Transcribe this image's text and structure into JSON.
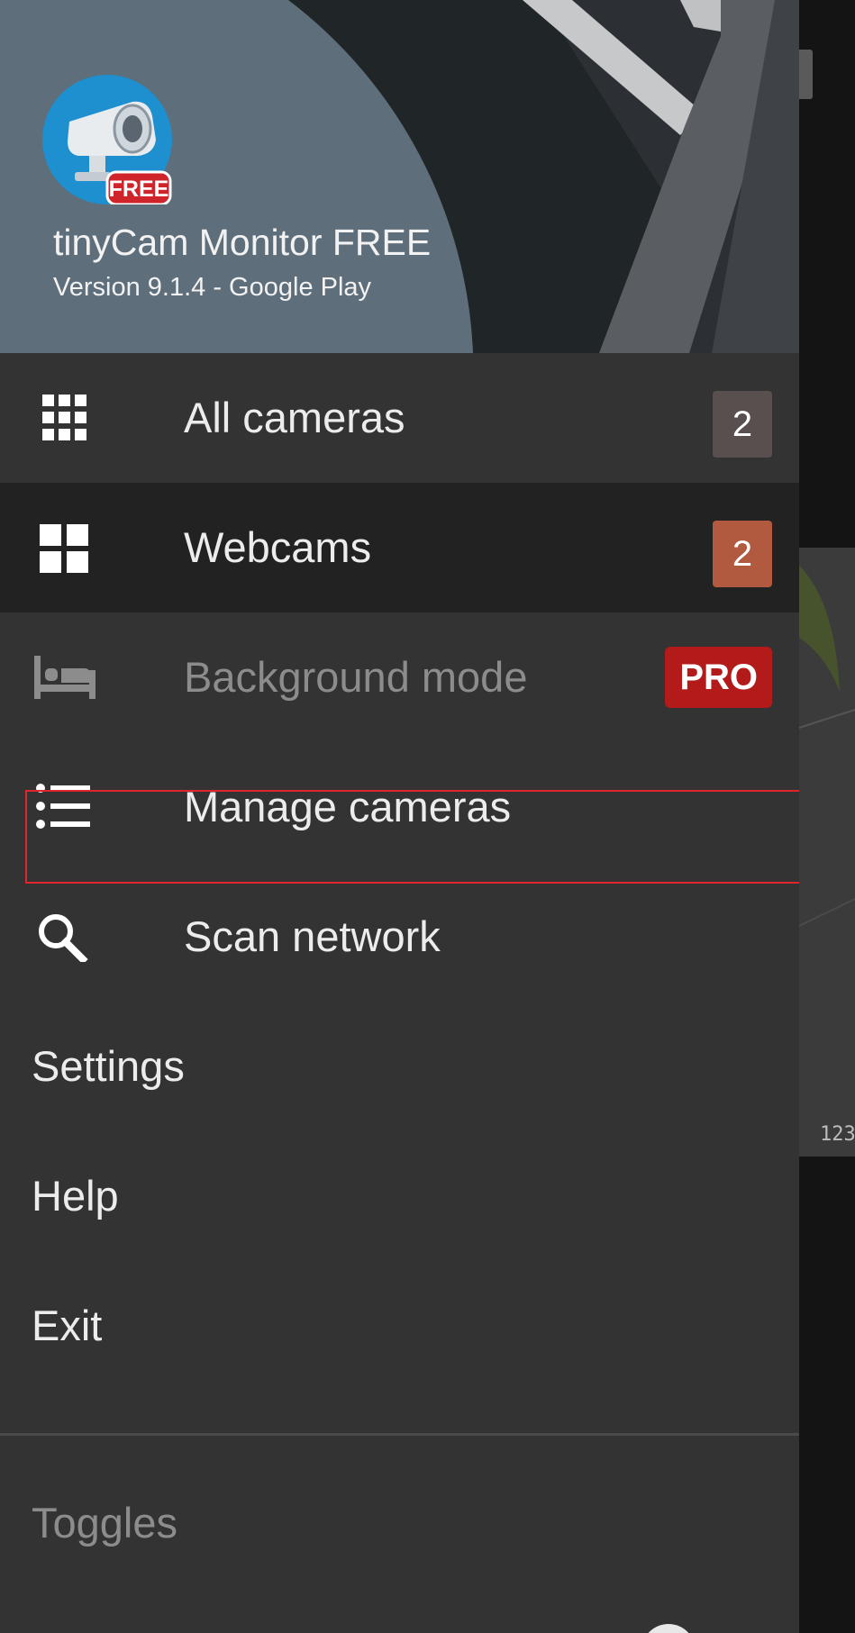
{
  "header": {
    "app_name": "tinyCam Monitor FREE",
    "version": "Version 9.1.4 - Google Play",
    "logo_badge": "FREE"
  },
  "menu": {
    "items": [
      {
        "label": "All cameras",
        "icon": "grid-3x3-icon",
        "badge": "2",
        "active": false
      },
      {
        "label": "Webcams",
        "icon": "grid-2x2-icon",
        "badge": "2",
        "active": true
      },
      {
        "label": "Background mode",
        "icon": "bed-icon",
        "badge": "PRO",
        "disabled": true
      },
      {
        "label": "Manage cameras",
        "icon": "list-icon",
        "highlighted": true
      },
      {
        "label": "Scan network",
        "icon": "search-icon"
      },
      {
        "label": "Settings"
      },
      {
        "label": "Help"
      },
      {
        "label": "Exit"
      }
    ],
    "section_title": "Toggles"
  },
  "background": {
    "thumbnail_label": "123"
  },
  "colors": {
    "drawer_bg": "#333333",
    "active_row_bg": "#222222",
    "badge_gray": "#5a4f4f",
    "badge_orange": "#b15a3f",
    "badge_pro": "#b31b1b",
    "highlight_border": "#e0262b",
    "header_circle": "#5e6e7a"
  }
}
